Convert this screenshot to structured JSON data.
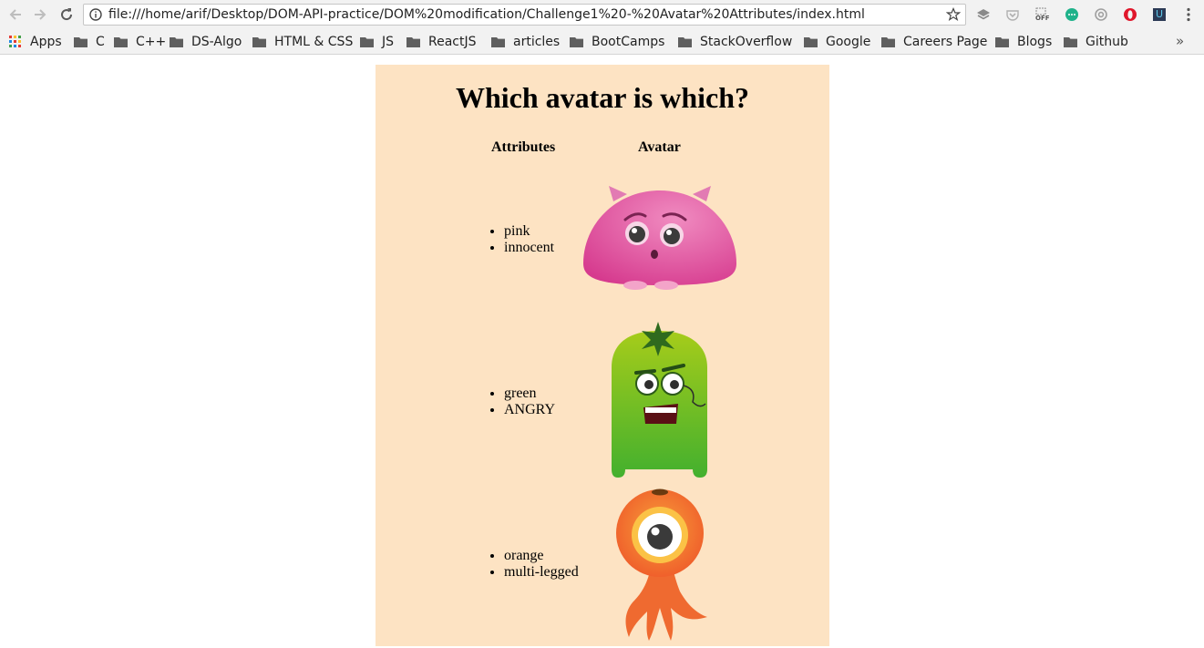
{
  "browser": {
    "url": "file:///home/arif/Desktop/DOM-API-practice/DOM%20modification/Challenge1%20-%20Avatar%20Attributes/index.html",
    "bookmarks": [
      "Apps",
      "C",
      "C++",
      "DS-Algo",
      "HTML & CSS",
      "JS",
      "ReactJS",
      "articles",
      "BootCamps",
      "StackOverflow",
      "Google",
      "Careers Page",
      "Blogs",
      "Github"
    ],
    "more_bookmarks": "»",
    "extensions": [
      "layers-icon",
      "pocket-icon",
      "off-icon",
      "chat-icon",
      "at-sign-icon",
      "opera-icon",
      "udacity-icon"
    ],
    "off_label": "OFF",
    "udacity_label": "U"
  },
  "page": {
    "title": "Which avatar is which?",
    "headers": {
      "attributes": "Attributes",
      "avatar": "Avatar"
    },
    "rows": [
      {
        "attributes": [
          "pink",
          "innocent"
        ],
        "avatar": "pink-monster-icon"
      },
      {
        "attributes": [
          "green",
          "ANGRY"
        ],
        "avatar": "green-monster-icon"
      },
      {
        "attributes": [
          "orange",
          "multi-legged"
        ],
        "avatar": "orange-monster-icon"
      }
    ],
    "colors": {
      "card_background": "#fde3c3",
      "pink": "#e04fa0",
      "green": "#5cb82c",
      "orange": "#f26a2e"
    }
  }
}
